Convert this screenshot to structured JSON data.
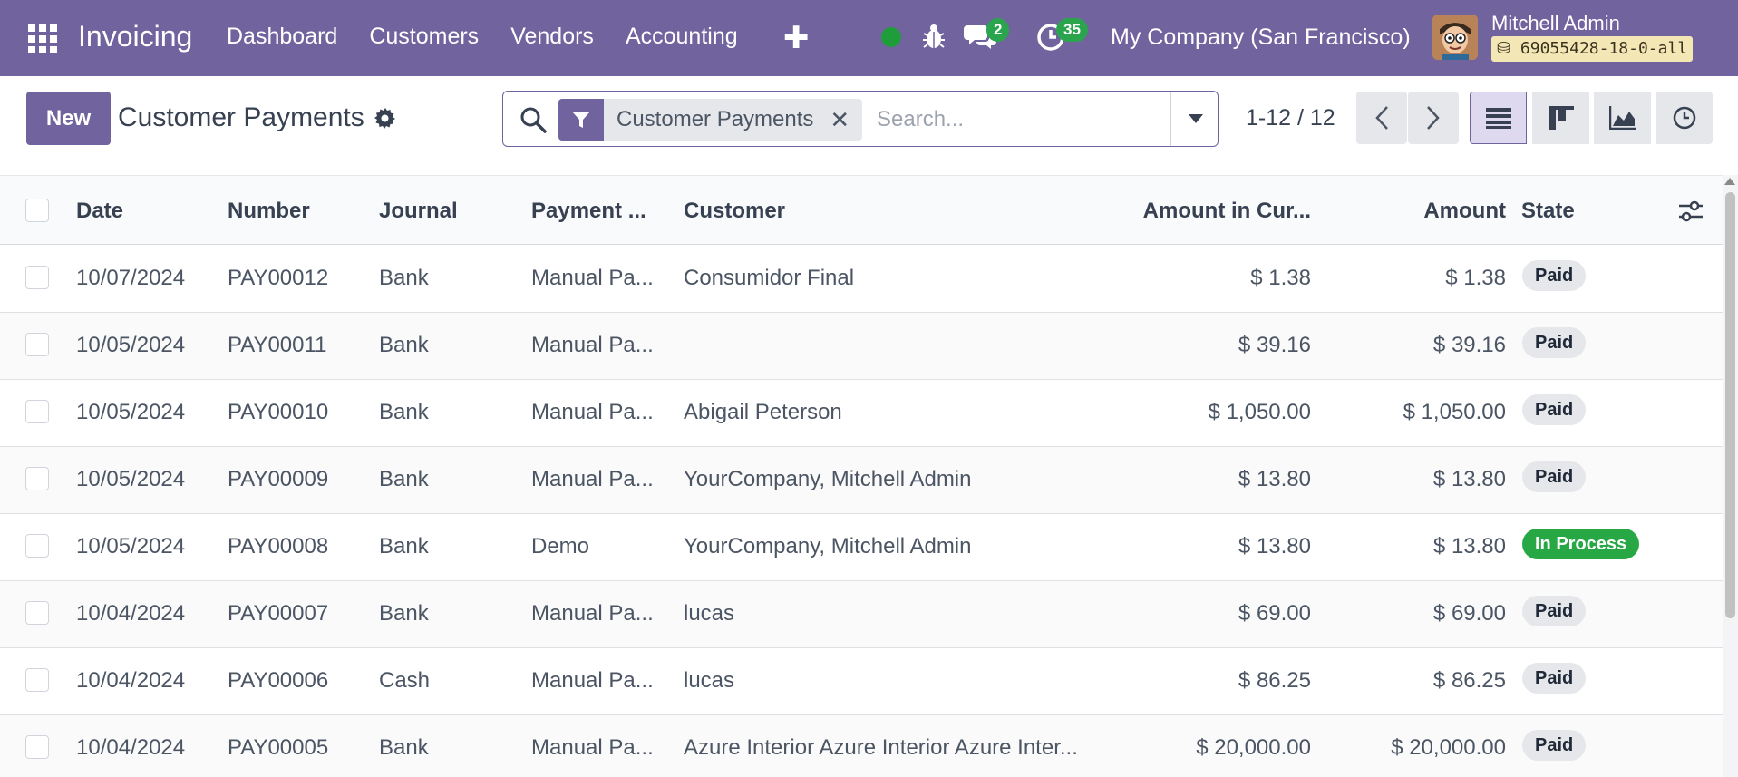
{
  "navbar": {
    "app_name": "Invoicing",
    "menu": [
      "Dashboard",
      "Customers",
      "Vendors",
      "Accounting"
    ],
    "messages_count": "2",
    "activities_count": "35",
    "company": "My Company (San Francisco)",
    "user_name": "Mitchell Admin",
    "db_name": "69055428-18-0-all",
    "colors": {
      "navbar_bg": "#71639e",
      "status_online": "#1f9d3a",
      "badge_bg": "#2ba44e"
    }
  },
  "control_panel": {
    "new_label": "New",
    "title": "Customer Payments",
    "search": {
      "facet_label": "Customer Payments",
      "placeholder": "Search..."
    },
    "pager": "1-12 / 12"
  },
  "table": {
    "columns": [
      "Date",
      "Number",
      "Journal",
      "Payment ...",
      "Customer",
      "Amount in Cur...",
      "Amount",
      "State"
    ],
    "rows": [
      {
        "date": "10/07/2024",
        "number": "PAY00012",
        "journal": "Bank",
        "method": "Manual Pa...",
        "customer": "Consumidor Final",
        "amount_cur": "$ 1.38",
        "amount": "$ 1.38",
        "state": "Paid"
      },
      {
        "date": "10/05/2024",
        "number": "PAY00011",
        "journal": "Bank",
        "method": "Manual Pa...",
        "customer": "",
        "amount_cur": "$ 39.16",
        "amount": "$ 39.16",
        "state": "Paid"
      },
      {
        "date": "10/05/2024",
        "number": "PAY00010",
        "journal": "Bank",
        "method": "Manual Pa...",
        "customer": "Abigail Peterson",
        "amount_cur": "$ 1,050.00",
        "amount": "$ 1,050.00",
        "state": "Paid"
      },
      {
        "date": "10/05/2024",
        "number": "PAY00009",
        "journal": "Bank",
        "method": "Manual Pa...",
        "customer": "YourCompany, Mitchell Admin",
        "amount_cur": "$ 13.80",
        "amount": "$ 13.80",
        "state": "Paid"
      },
      {
        "date": "10/05/2024",
        "number": "PAY00008",
        "journal": "Bank",
        "method": "Demo",
        "customer": "YourCompany, Mitchell Admin",
        "amount_cur": "$ 13.80",
        "amount": "$ 13.80",
        "state": "In Process"
      },
      {
        "date": "10/04/2024",
        "number": "PAY00007",
        "journal": "Bank",
        "method": "Manual Pa...",
        "customer": "lucas",
        "amount_cur": "$ 69.00",
        "amount": "$ 69.00",
        "state": "Paid"
      },
      {
        "date": "10/04/2024",
        "number": "PAY00006",
        "journal": "Cash",
        "method": "Manual Pa...",
        "customer": "lucas",
        "amount_cur": "$ 86.25",
        "amount": "$ 86.25",
        "state": "Paid"
      },
      {
        "date": "10/04/2024",
        "number": "PAY00005",
        "journal": "Bank",
        "method": "Manual Pa...",
        "customer": "Azure Interior Azure Interior Azure Inter...",
        "amount_cur": "$ 20,000.00",
        "amount": "$ 20,000.00",
        "state": "Paid"
      }
    ],
    "colors": {
      "state_in_process": "#28a745",
      "state_paid": "#e5e7eb"
    }
  }
}
